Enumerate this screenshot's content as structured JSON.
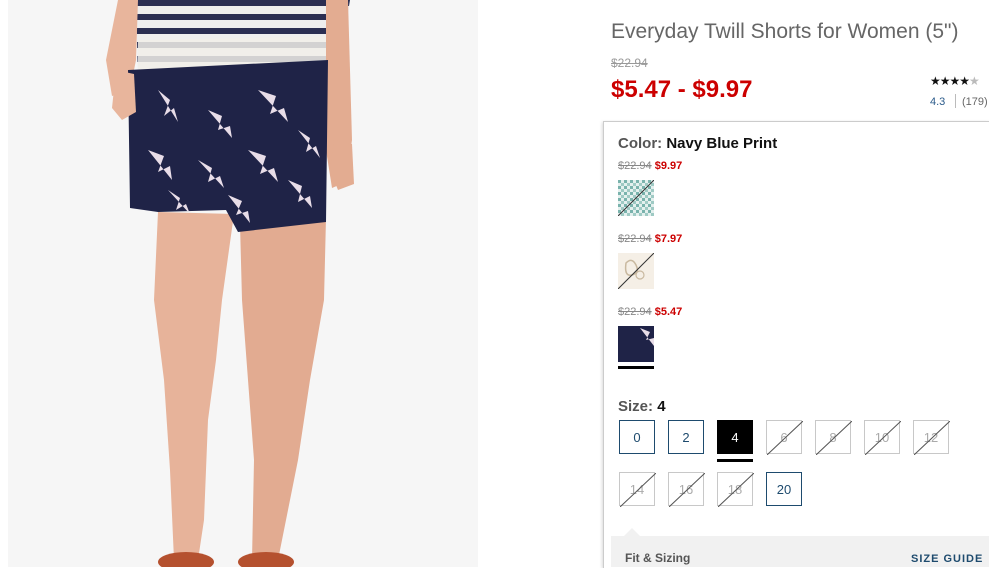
{
  "product": {
    "title": "Everyday Twill Shorts for Women (5\")",
    "original_price": "$22.94",
    "price_range": "$5.47 - $9.97",
    "rating": {
      "stars": "★★★★",
      "half": "★",
      "value": "4.3",
      "count": "(179)"
    }
  },
  "color": {
    "label": "Color:",
    "selected": "Navy Blue Print",
    "swatches": [
      {
        "old": "$22.94",
        "new": "$9.97",
        "name": "Aqua Check",
        "available": false
      },
      {
        "old": "$22.94",
        "new": "$7.97",
        "name": "Cream Floral",
        "available": false
      },
      {
        "old": "$22.94",
        "new": "$5.47",
        "name": "Navy Blue Print",
        "available": true,
        "selected": true
      }
    ]
  },
  "size": {
    "label": "Size:",
    "selected": "4",
    "options": [
      {
        "label": "0",
        "available": true
      },
      {
        "label": "2",
        "available": true
      },
      {
        "label": "4",
        "available": true,
        "selected": true
      },
      {
        "label": "6",
        "available": false
      },
      {
        "label": "8",
        "available": false
      },
      {
        "label": "10",
        "available": false
      },
      {
        "label": "12",
        "available": false
      },
      {
        "label": "14",
        "available": false
      },
      {
        "label": "16",
        "available": false
      },
      {
        "label": "18",
        "available": false
      },
      {
        "label": "20",
        "available": true
      }
    ]
  },
  "fit": {
    "label": "Fit & Sizing",
    "guide_link": "SIZE GUIDE"
  },
  "colors": {
    "sale_red": "#cc0000",
    "link_navy": "#1e4b6e",
    "print_navy": "#1f2347"
  }
}
